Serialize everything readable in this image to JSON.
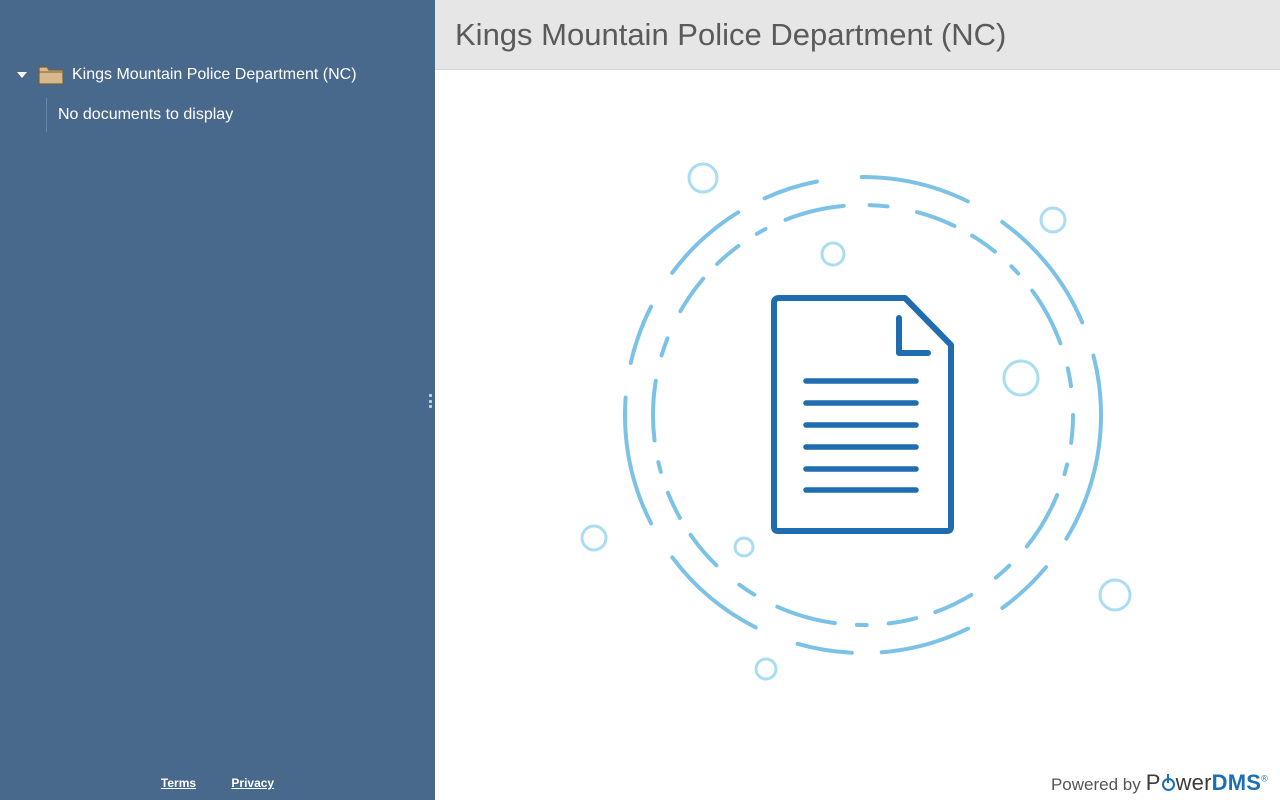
{
  "sidebar": {
    "tree": {
      "root_label": "Kings Mountain Police Department (NC)",
      "expanded": true,
      "empty_message": "No documents to display"
    },
    "footer": {
      "terms_label": "Terms",
      "privacy_label": "Privacy"
    }
  },
  "main": {
    "title": "Kings Mountain Police Department (NC)",
    "illustration": "document-icon",
    "powered_by": {
      "prefix": "Powered by",
      "brand_start": "P",
      "brand_mid": "wer",
      "brand_end": "DMS"
    }
  },
  "colors": {
    "sidebar_bg": "#48688c",
    "header_bg": "#e6e6e6",
    "accent": "#1c6fb3",
    "ring": "#7cc2e6",
    "bubble": "#aadcf2",
    "folder": "#d8b98e"
  }
}
